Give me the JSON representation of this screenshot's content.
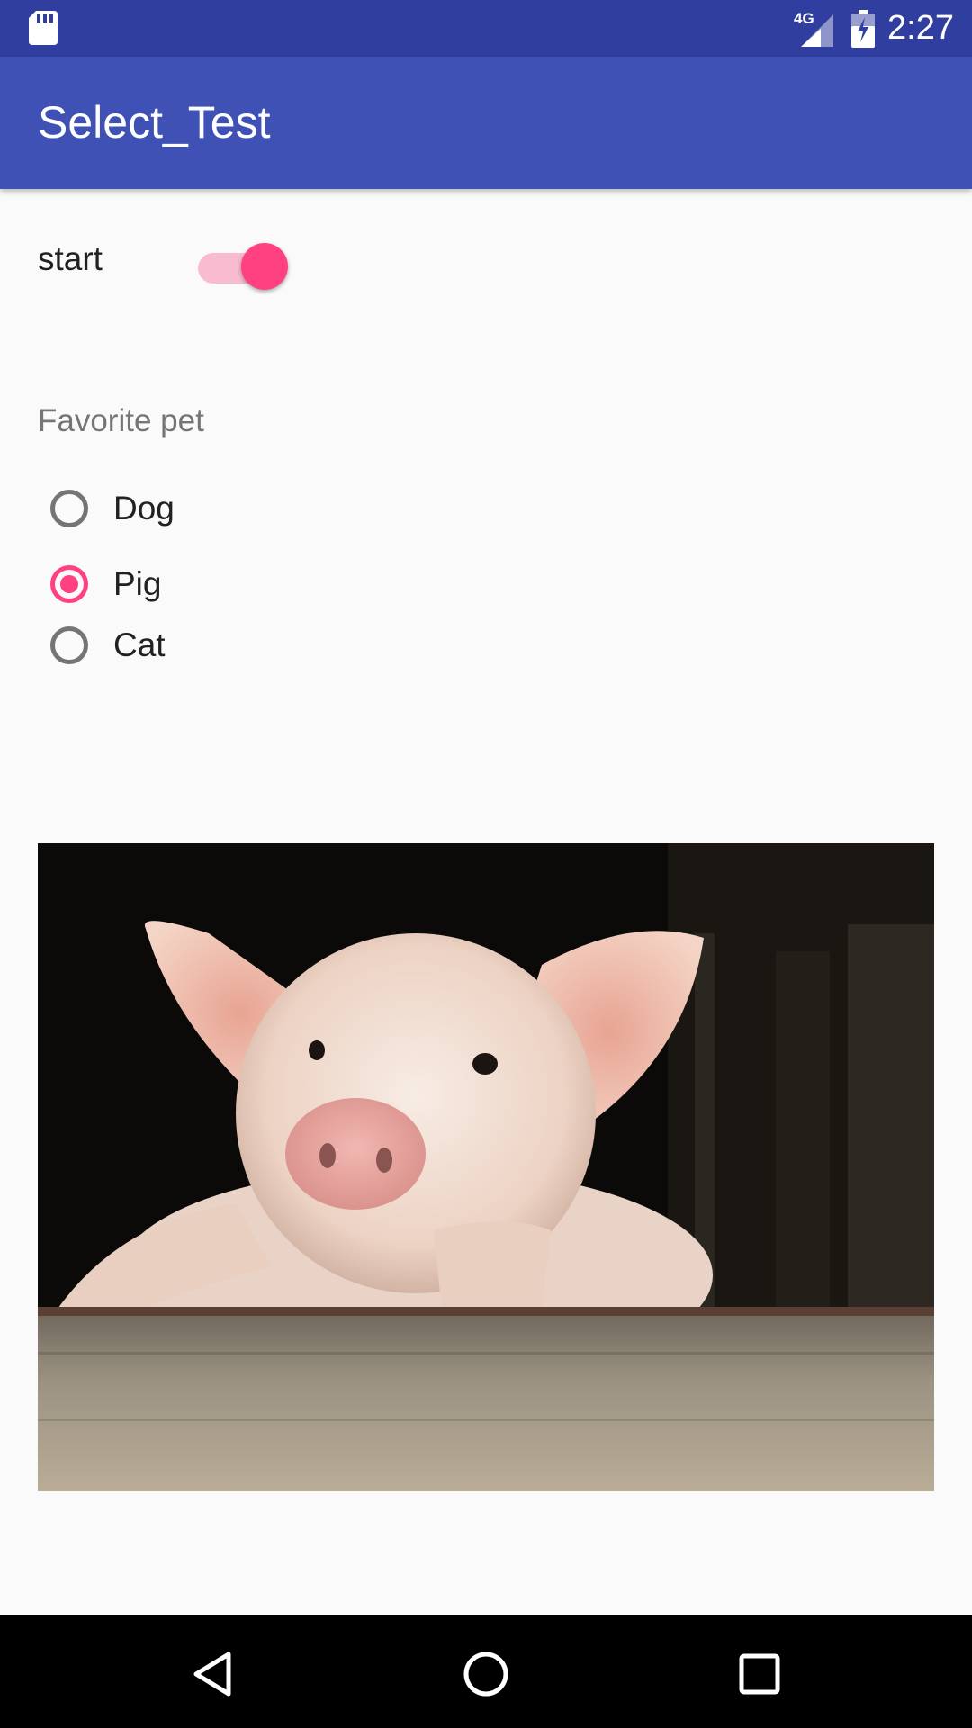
{
  "status_bar": {
    "network": "4G",
    "time": "2:27",
    "icons": [
      "sd-card-icon",
      "signal-4g-icon",
      "battery-charging-icon"
    ]
  },
  "app_bar": {
    "title": "Select_Test"
  },
  "switch_row": {
    "label": "start",
    "checked": true
  },
  "pet_group": {
    "label": "Favorite pet",
    "options": [
      {
        "label": "Dog",
        "checked": false
      },
      {
        "label": "Pig",
        "checked": true
      },
      {
        "label": "Cat",
        "checked": false
      }
    ]
  },
  "image": {
    "subject": "pig-photo"
  },
  "nav_bar": {
    "buttons": [
      "back-icon",
      "home-icon",
      "recents-icon"
    ]
  },
  "colors": {
    "primary": "#3f51b5",
    "primary_dark": "#303f9f",
    "accent": "#ff4081"
  }
}
